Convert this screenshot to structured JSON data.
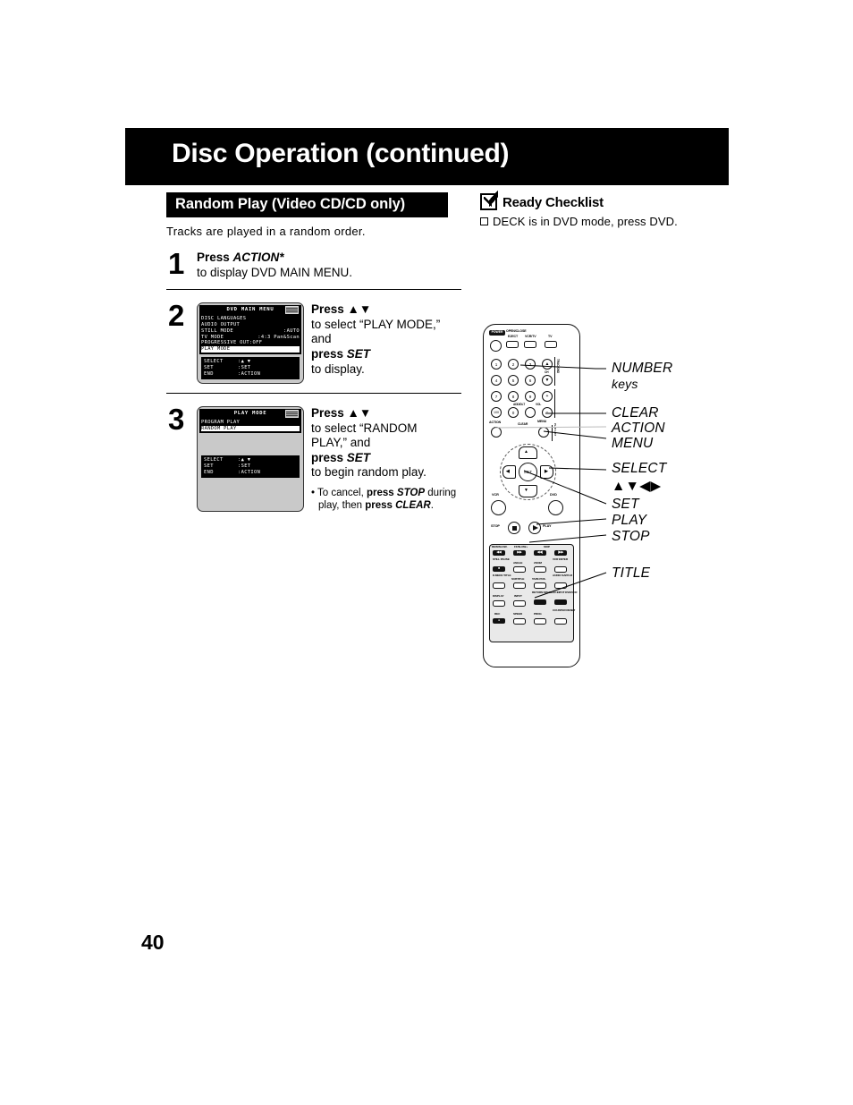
{
  "page": {
    "title": "Disc Operation (continued)",
    "number": "40"
  },
  "section": {
    "bar_label": "Random Play (Video CD/CD only)",
    "intro": "Tracks are played in a random order."
  },
  "ready_checklist": {
    "check_icon": "checkmark-icon",
    "title": "Ready Checklist",
    "items": [
      {
        "box_icon": "empty-checkbox-icon",
        "text": "DECK is in DVD mode, press DVD."
      }
    ]
  },
  "steps": [
    {
      "number": "1",
      "line1_bold": "Press ",
      "line1_italic": "ACTION*",
      "line2": "to display DVD MAIN MENU."
    },
    {
      "number": "2",
      "line1_bold": "Press ",
      "line1_arrows": "▲▼",
      "line2": "to select “PLAY MODE,”",
      "line3": "and",
      "line4_bold": "press ",
      "line4_italic": "SET",
      "line5": "to display."
    },
    {
      "number": "3",
      "line1_bold": "Press ",
      "line1_arrows": "▲▼",
      "line2": "to select “RANDOM",
      "line3": "PLAY,” and",
      "line4_bold": "press ",
      "line4_italic": "SET",
      "line5": "to begin random play.",
      "note": {
        "bullet": "•",
        "t1": "To cancel, ",
        "t2": "press ",
        "t3": "STOP",
        "t4": " during play, then ",
        "t5": "press",
        "t6": "CLEAR",
        "t7": "."
      }
    }
  ],
  "osd_main_menu": {
    "title": "DVD MAIN MENU",
    "corner_icon": "disc-type-icon",
    "rows": [
      {
        "label": "DISC LANGUAGES",
        "value": "",
        "selected": false
      },
      {
        "label": "AUDIO OUTPUT",
        "value": "",
        "selected": false
      },
      {
        "label": "STILL MODE",
        "value": ":AUTO",
        "selected": false
      },
      {
        "label": "TV MODE",
        "value": ":4:3 Pan&Scan",
        "selected": false
      },
      {
        "label": "PROGRESSIVE OUT:OFF",
        "value": "",
        "selected": false
      },
      {
        "label": "PLAY MODE",
        "value": "",
        "selected": true
      }
    ],
    "footer": [
      {
        "key": "SELECT",
        "value": ":▲ ▼"
      },
      {
        "key": "SET",
        "value": ":SET"
      },
      {
        "key": "END",
        "value": ":ACTION"
      }
    ]
  },
  "osd_play_mode": {
    "title": "PLAY MODE",
    "corner_icon": "disc-type-icon",
    "rows": [
      {
        "label": "PROGRAM PLAY",
        "value": "",
        "selected": false
      },
      {
        "label": "RANDOM PLAY",
        "value": "",
        "selected": true
      }
    ],
    "footer": [
      {
        "key": "SELECT",
        "value": ":▲ ▼"
      },
      {
        "key": "SET",
        "value": ":SET"
      },
      {
        "key": "END",
        "value": ":ACTION"
      }
    ]
  },
  "remote": {
    "callouts": [
      {
        "label": "NUMBER",
        "sub": "keys"
      },
      {
        "label": "CLEAR",
        "sub": ""
      },
      {
        "label": "ACTION",
        "sub": ""
      },
      {
        "label": "MENU",
        "sub": ""
      },
      {
        "label": "SELECT",
        "sub": "▲▼◀▶"
      },
      {
        "label": "SET",
        "sub": ""
      },
      {
        "label": "PLAY",
        "sub": ""
      },
      {
        "label": "STOP",
        "sub": ""
      },
      {
        "label": "TITLE",
        "sub": ""
      }
    ],
    "labels": {
      "power": "POWER",
      "open_close": "OPEN/CLOSE",
      "eject": "EJECT",
      "vcr_tv": "VCR/TV",
      "tv": "TV",
      "ch": "CH",
      "tracking": "TRACKING",
      "plus": "+",
      "minus": "−",
      "add_dlt": "ADD/DLT",
      "vol": "VOL",
      "action": "ACTION",
      "clear": "CLEAR",
      "menu": "MENU",
      "play_list": "PLAY LIST",
      "set": "SET",
      "vcr": "VCR",
      "dvd": "DVD",
      "stop": "STOP",
      "play": "PLAY",
      "rew_slow_minus": "REW/SLOW-",
      "ff_slow_plus": "FF/SLOW+",
      "skip": "SKIP",
      "still_pause": "STILL PAUSE",
      "angle": "ANGLE",
      "zoom": "ZOOM",
      "vcr_enter": "VCR ENTER",
      "dmenu_title": "D.MENU TITLE",
      "subtitle": "SUBTITLE",
      "tape_pos": "TAPE POS.",
      "audio_sap": "AUDIO SAP/V-R",
      "display": "DISPLAY",
      "input": "INPUT",
      "return_space": "RETURN SPACE",
      "av_input_dvd_vcr": "AV INPUT DVD/VCR",
      "rec": "REC",
      "speed": "SPEED",
      "prog": "PROG",
      "counter_reset": "COUNTER RESET"
    },
    "number_keys": [
      "1",
      "2",
      "3",
      "4",
      "5",
      "6",
      "7",
      "8",
      "9",
      "100",
      "0"
    ]
  }
}
